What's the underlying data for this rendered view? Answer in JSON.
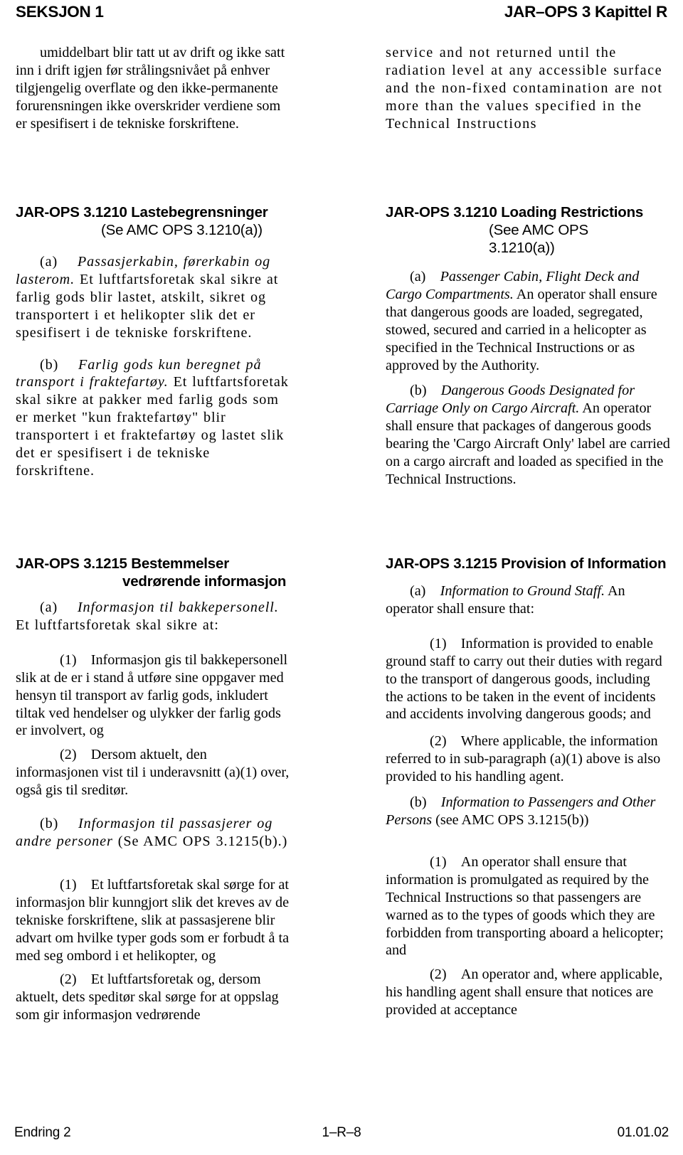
{
  "header": {
    "left": "SEKSJON 1",
    "right": "JAR–OPS 3 Kapittel R"
  },
  "footer": {
    "left": "Endring 2",
    "center": "1–R–8",
    "right": "01.01.02"
  },
  "left_column": {
    "continued_paragraph": "umiddelbart blir tatt ut av drift og ikke satt inn i drift igjen før strålingsnivået på enhver tilgjengelig overflate og den ikke-permanente forurensningen ikke overskrider verdiene som er spesifisert i de tekniske forskriftene.",
    "section_1210": {
      "heading": "JAR-OPS 3.1210 Lastebegrensninger",
      "heading_sub": "(Se AMC OPS 3.1210(a))",
      "para_a_label": "(a)",
      "para_a_italic": "Passasjerkabin, førerkabin og lasterom.",
      "para_a_text": "Et luftfartsforetak skal sikre at farlig gods blir lastet, atskilt, sikret og transportert i et helikopter slik det er spesifisert i de tekniske forskriftene.",
      "para_b_label": "(b)",
      "para_b_italic": "Farlig gods kun beregnet på transport i fraktefartøy.",
      "para_b_text": "Et luftfartsforetak skal sikre at pakker med farlig gods som er merket \"kun fraktefartøy\" blir transportert i et fraktefartøy og lastet slik det er spesifisert i de tekniske forskriftene."
    },
    "section_1215": {
      "heading": "JAR-OPS 3.1215 Bestemmelser",
      "heading_line2": "vedrørende informasjon",
      "para_a_label": "(a)",
      "para_a_italic": "Informasjon til bakkepersonell.",
      "para_a_text": "Et luftfartsforetak skal sikre at:",
      "item_a1_label": "(1)",
      "item_a1_text": "Informasjon gis til bakkepersonell slik at de er i stand å utføre sine oppgaver med hensyn til transport av farlig gods, inkludert tiltak ved hendelser og ulykker der farlig gods er involvert, og",
      "item_a2_label": "(2)",
      "item_a2_text": "Dersom aktuelt, den informasjonen vist til i underavsnitt (a)(1) over, også gis til sreditør.",
      "item_a2_text_correct": "Dersom aktuelt, den informasjonen vist til i underavsnitt (a)(1) over, også gis til sreditør.",
      "para_b_label": "(b)",
      "para_b_italic": "Informasjon til passasjerer og andre personer",
      "para_b_text": "(Se AMC OPS 3.1215(b).)",
      "item_b1_label": "(1)",
      "item_b1_text": "Et luftfartsforetak skal sørge for at informasjon blir kunngjort slik det kreves av de tekniske forskriftene, slik at passasjerene blir advart om hvilke typer gods som er forbudt å ta med seg ombord i et helikopter, og",
      "item_b2_label": "(2)",
      "item_b2_text": "Et luftfartsforetak og, dersom aktuelt, dets speditør skal sørge for at oppslag som gir informasjon vedrørende"
    }
  },
  "right_column": {
    "continued_paragraph": "service and not returned until the radiation level at any accessible surface and the non-fixed contamination are not more than the values specified in the Technical Instructions",
    "section_1210": {
      "heading": "JAR-OPS 3.1210 Loading Restrictions",
      "heading_sub_line1": "(See AMC OPS",
      "heading_sub_line2": "3.1210(a))",
      "para_a_label": "(a)",
      "para_a_italic": "Passenger Cabin, Flight Deck and Cargo Compartments.",
      "para_a_text": "An operator shall ensure that dangerous goods are loaded, segregated, stowed, secured and carried in a helicopter as specified in the Technical Instructions or as approved by the Authority.",
      "para_b_label": "(b)",
      "para_b_italic": "Dangerous Goods Designated for Carriage Only on Cargo Aircraft.",
      "para_b_text": "An operator shall ensure that packages of dangerous goods bearing the 'Cargo Aircraft Only' label are carried on a cargo aircraft and loaded as specified in the Technical Instructions."
    },
    "section_1215": {
      "heading": "JAR-OPS 3.1215 Provision of Information",
      "para_a_label": "(a)",
      "para_a_italic": "Information to Ground Staff.",
      "para_a_text": "An operator shall ensure that:",
      "item_a1_label": "(1)",
      "item_a1_text": "Information is provided to enable ground staff to carry out their duties with regard to the transport of dangerous goods, including the actions to be taken in the event of incidents and accidents involving dangerous goods; and",
      "item_a2_label": "(2)",
      "item_a2_text": "Where applicable, the information referred to in sub-paragraph (a)(1) above is also provided to his handling agent.",
      "para_b_label": "(b)",
      "para_b_italic": "Information to Passengers and Other Persons",
      "para_b_text": "(see AMC OPS 3.1215(b))",
      "item_b1_label": "(1)",
      "item_b1_text": "An operator shall ensure that information is promulgated as required by the Technical Instructions so that passengers are warned as to the types of goods which they are forbidden from transporting aboard a helicopter; and",
      "item_b2_label": "(2)",
      "item_b2_text": "An operator and, where applicable, his handling agent shall ensure that notices are provided at acceptance"
    }
  }
}
